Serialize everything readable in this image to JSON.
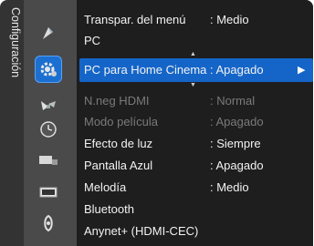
{
  "sidebar": {
    "label": "Configuración"
  },
  "icons": [
    {
      "name": "picture-icon"
    },
    {
      "name": "setup-gear-icon"
    },
    {
      "name": "satellite-dish-icon"
    },
    {
      "name": "clock-icon"
    },
    {
      "name": "input-source-icon"
    },
    {
      "name": "screen-icon"
    },
    {
      "name": "anynet-icon"
    }
  ],
  "menu": {
    "items": [
      {
        "label": "Transpar. del menú",
        "value": ": Medio",
        "state": "normal"
      },
      {
        "label": "PC",
        "value": "",
        "state": "normal"
      },
      {
        "label": "PC para Home Cinema",
        "value": ": Apagado",
        "state": "selected",
        "arrow": "▶"
      },
      {
        "label": "N.neg HDMI",
        "value": ": Normal",
        "state": "disabled"
      },
      {
        "label": "Modo película",
        "value": ": Apagado",
        "state": "disabled"
      },
      {
        "label": "Efecto de luz",
        "value": ": Siempre",
        "state": "normal"
      },
      {
        "label": "Pantalla Azul",
        "value": ": Apagado",
        "state": "normal"
      },
      {
        "label": "Melodía",
        "value": ": Medio",
        "state": "normal"
      },
      {
        "label": "Bluetooth",
        "value": "",
        "state": "normal"
      },
      {
        "label": "Anynet+ (HDMI-CEC)",
        "value": "",
        "state": "normal"
      }
    ]
  },
  "colors": {
    "highlight": "#1565c8",
    "menu_bg": "#1e1e1e",
    "icon_column_bg": "#4a4a4a",
    "disabled_text": "#7a7a7a"
  }
}
